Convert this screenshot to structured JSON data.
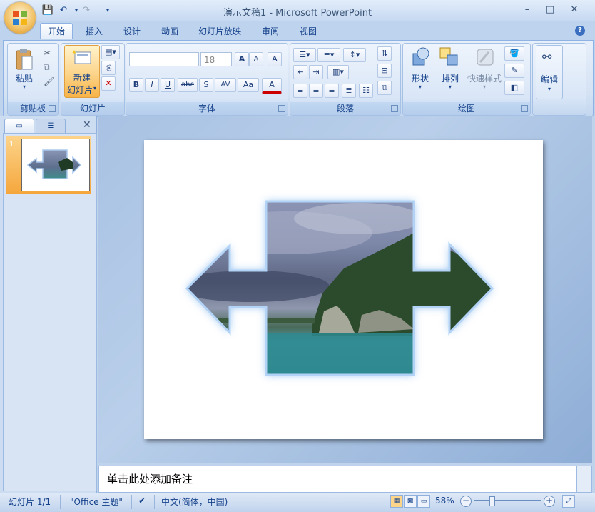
{
  "window": {
    "title": "演示文稿1 - Microsoft PowerPoint",
    "minimize_icon": "–",
    "maximize_icon": "□",
    "close_icon": "✕"
  },
  "quick_access": {
    "save_icon": "💾",
    "undo_icon": "↶",
    "redo_icon": "↷",
    "customize_icon": "▾"
  },
  "tabs": [
    "开始",
    "插入",
    "设计",
    "动画",
    "幻灯片放映",
    "审阅",
    "视图"
  ],
  "active_tab": "开始",
  "help_icon": "?",
  "ribbon": {
    "clipboard": {
      "label": "剪贴板",
      "paste_label": "粘贴",
      "paste_arrow": "▾"
    },
    "slides": {
      "label": "幻灯片",
      "new_slide_line1": "新建",
      "new_slide_line2": "幻灯片",
      "new_slide_arrow": "▾"
    },
    "font": {
      "label": "字体",
      "font_name_value": "",
      "font_size_value": "18",
      "grow_font": "A",
      "shrink_font": "A",
      "clear_format": "A",
      "bold": "B",
      "italic": "I",
      "underline": "U",
      "strikethrough": "abc",
      "shadow": "S",
      "char_spacing": "AV",
      "change_case": "Aa",
      "font_color": "A"
    },
    "paragraph": {
      "label": "段落"
    },
    "drawing": {
      "label": "绘图",
      "shapes_label": "形状",
      "arrange_label": "排列",
      "quick_styles_label": "快速样式",
      "dropdown_arrow": "▾"
    },
    "editing": {
      "label": "编辑",
      "dropdown_arrow": "▾"
    }
  },
  "slides_pane": {
    "close_icon": "✕",
    "slide_number": "1"
  },
  "notes": {
    "placeholder": "单击此处添加备注"
  },
  "status_bar": {
    "slide_info": "幻灯片 1/1",
    "theme": "\"Office 主题\"",
    "language": "中文(简体，中国)",
    "zoom_percent": "58%",
    "zoom_out": "−",
    "zoom_in": "+",
    "zoom_level": 0.58
  },
  "colors": {
    "ribbon_bg": "#d4e2f4",
    "active_button": "#fcd48a",
    "slide_selected": "#f5a63c",
    "accent_text": "#15428b"
  }
}
